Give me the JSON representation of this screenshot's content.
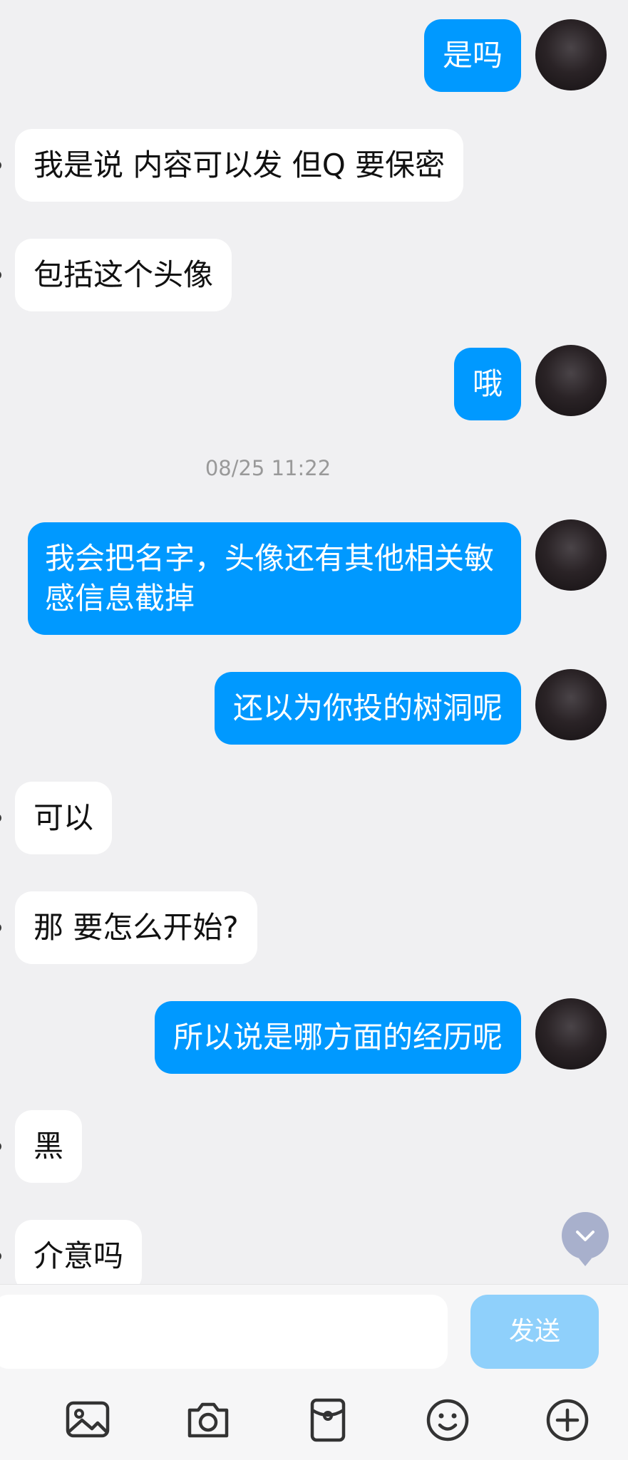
{
  "messages": [
    {
      "side": "out",
      "text": "是吗"
    },
    {
      "side": "in",
      "text": "我是说  内容可以发  但Q 要保密"
    },
    {
      "side": "in",
      "text": "包括这个头像"
    },
    {
      "side": "out",
      "text": "哦"
    },
    {
      "side": "out",
      "text": "我会把名字，头像还有其他相关敏感信息截掉"
    },
    {
      "side": "out",
      "text": "还以为你投的树洞呢"
    },
    {
      "side": "in",
      "text": "可以"
    },
    {
      "side": "in",
      "text": "那  要怎么开始?"
    },
    {
      "side": "out",
      "text": "所以说是哪方面的经历呢"
    },
    {
      "side": "in",
      "text": "黑"
    },
    {
      "side": "in",
      "text": "介意吗"
    }
  ],
  "timestamp": "08/25 11:22",
  "composer": {
    "input_value": "",
    "send_label": "发送"
  },
  "toolbar": {
    "icons": [
      "image-icon",
      "camera-icon",
      "red-packet-icon",
      "emoji-icon",
      "plus-icon"
    ]
  },
  "colors": {
    "outgoing_bubble": "#0099ff",
    "incoming_bubble": "#ffffff",
    "background": "#f0f0f2",
    "send_button": "#8fd0fb"
  }
}
